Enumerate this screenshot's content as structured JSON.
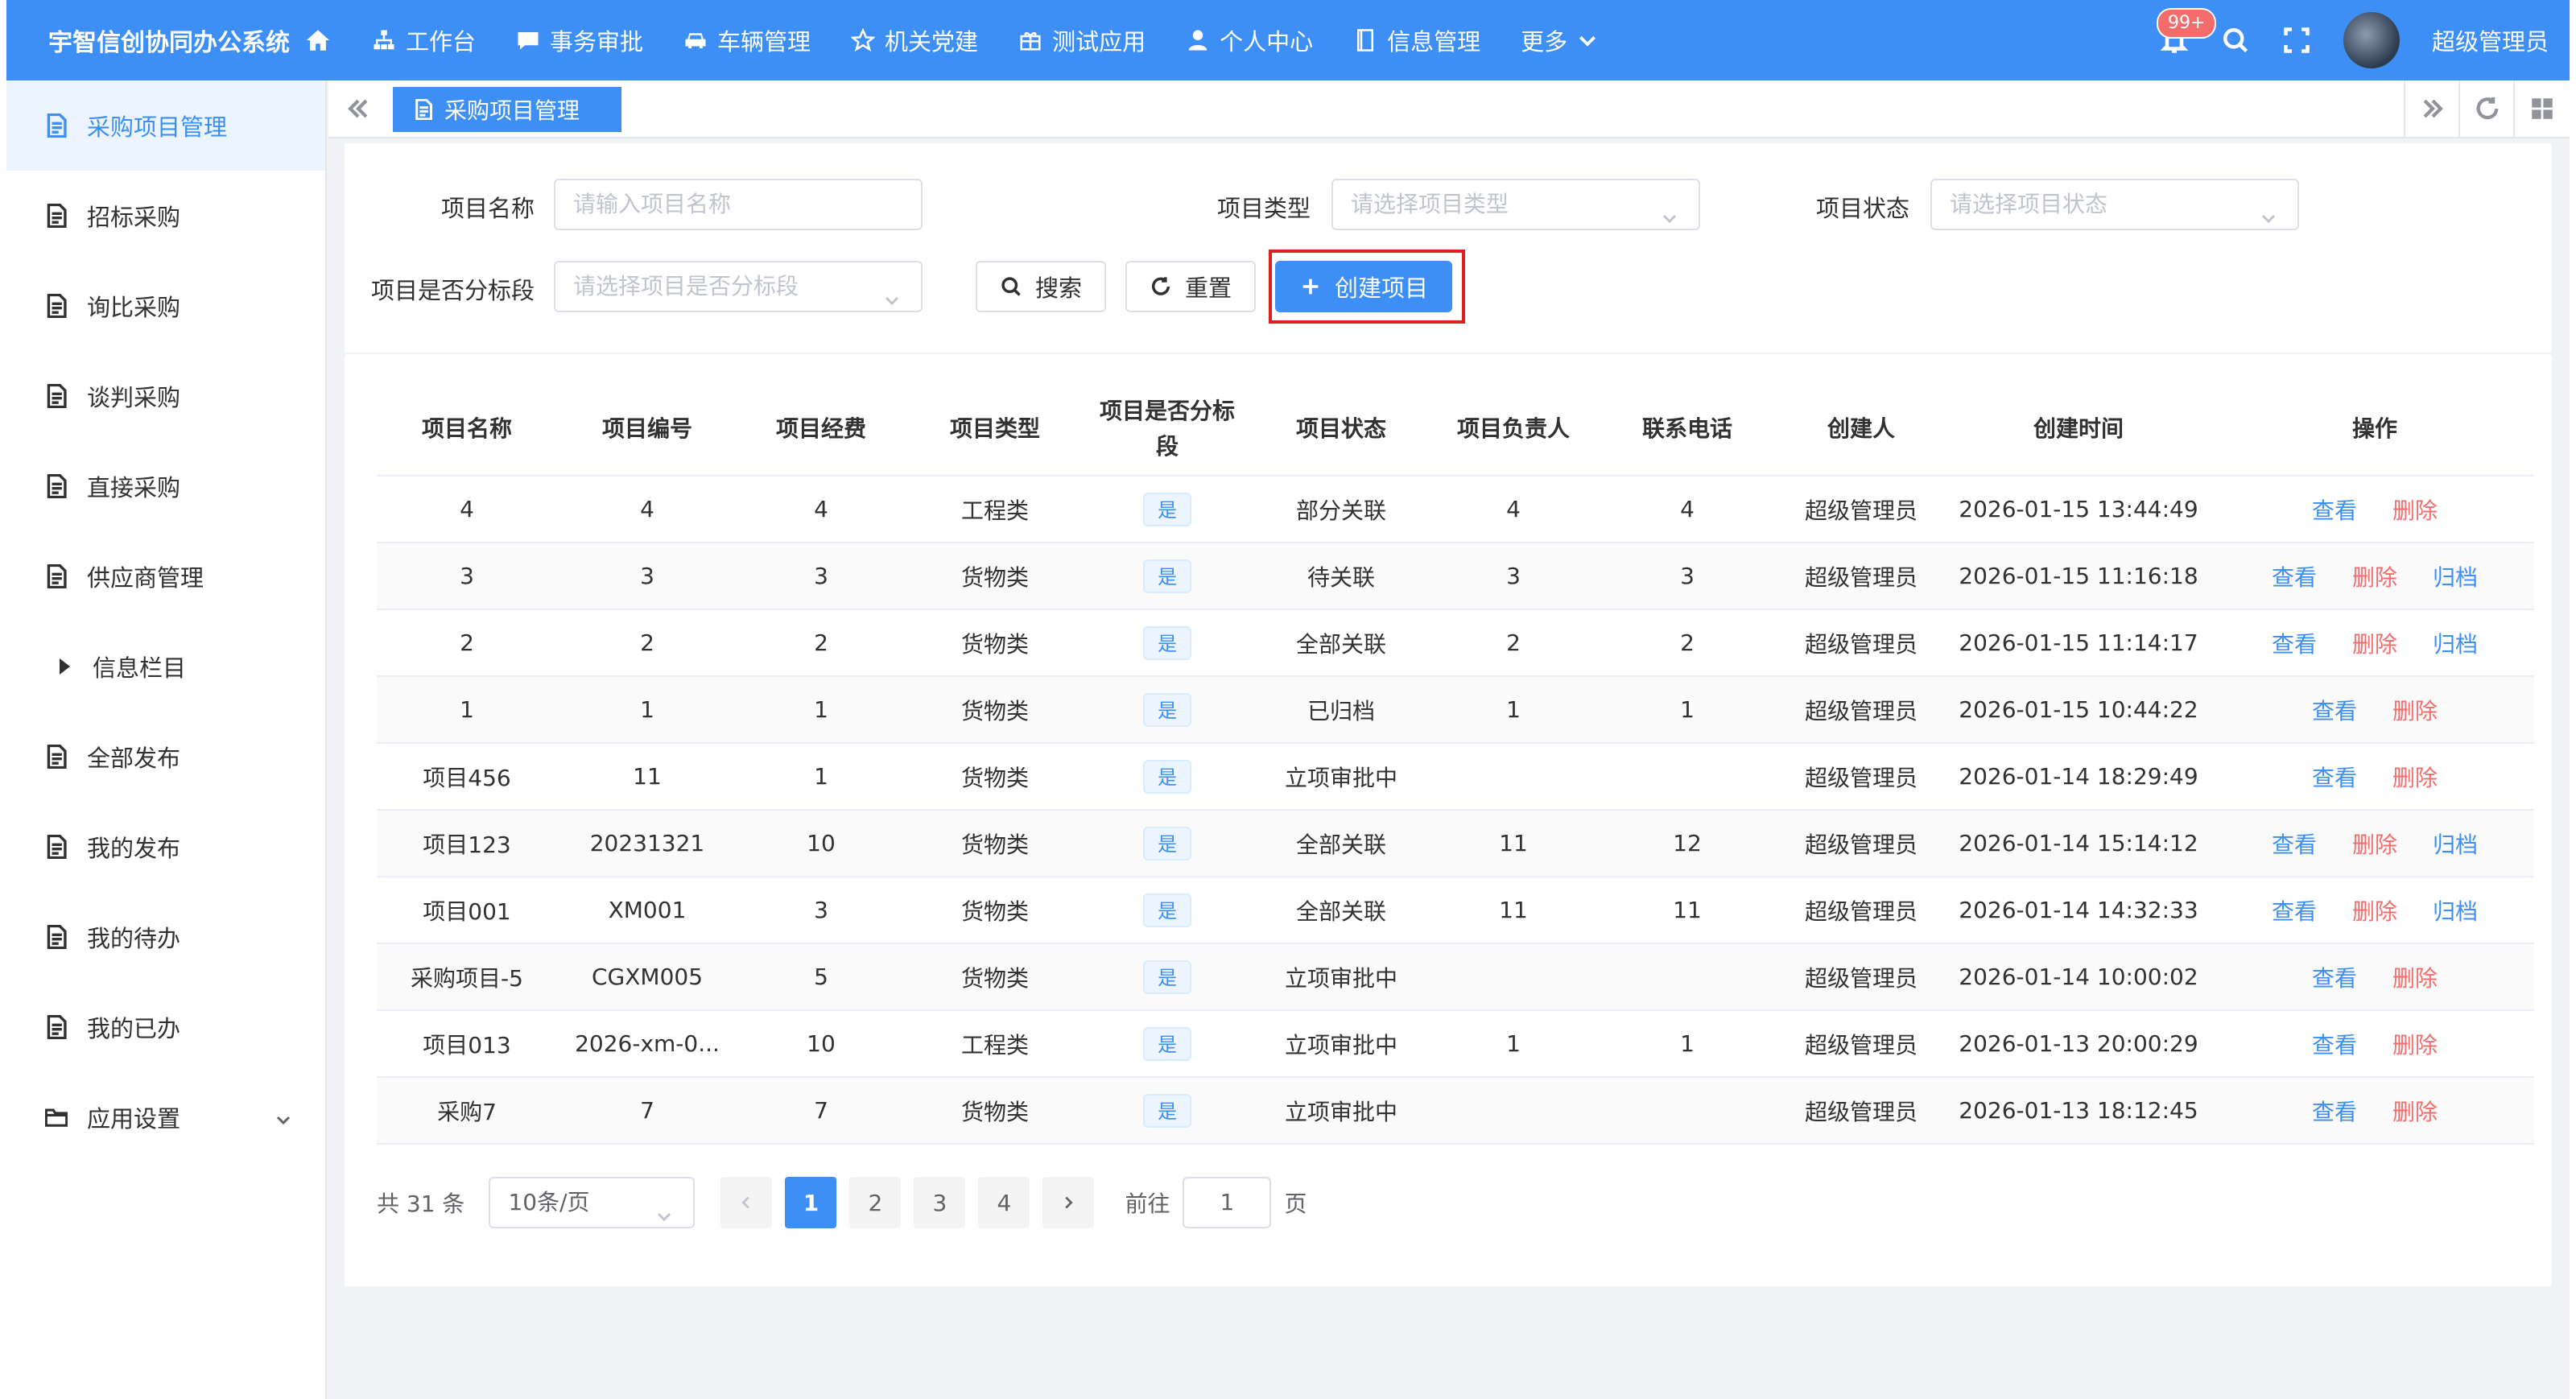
{
  "app": {
    "title": "宇智信创协同办公系统"
  },
  "nav": {
    "items": [
      {
        "label": "工作台"
      },
      {
        "label": "事务审批"
      },
      {
        "label": "车辆管理"
      },
      {
        "label": "机关党建"
      },
      {
        "label": "测试应用"
      },
      {
        "label": "个人中心"
      },
      {
        "label": "信息管理"
      },
      {
        "label": "更多"
      }
    ]
  },
  "header": {
    "notification_count": "99+",
    "user_name": "超级管理员"
  },
  "sidebar": {
    "items": [
      {
        "label": "采购项目管理",
        "icon": "document-icon",
        "active": true
      },
      {
        "label": "招标采购",
        "icon": "document-icon"
      },
      {
        "label": "询比采购",
        "icon": "document-icon"
      },
      {
        "label": "谈判采购",
        "icon": "document-icon"
      },
      {
        "label": "直接采购",
        "icon": "document-icon"
      },
      {
        "label": "供应商管理",
        "icon": "document-icon"
      },
      {
        "label": "信息栏目",
        "icon": "caret-right-icon"
      },
      {
        "label": "全部发布",
        "icon": "document-icon"
      },
      {
        "label": "我的发布",
        "icon": "document-icon"
      },
      {
        "label": "我的待办",
        "icon": "document-icon"
      },
      {
        "label": "我的已办",
        "icon": "document-icon"
      },
      {
        "label": "应用设置",
        "icon": "folder-icon"
      }
    ]
  },
  "tabs": {
    "active_label": "采购项目管理"
  },
  "search": {
    "name_label": "项目名称",
    "name_placeholder": "请输入项目名称",
    "type_label": "项目类型",
    "type_placeholder": "请选择项目类型",
    "status_label": "项目状态",
    "status_placeholder": "请选择项目状态",
    "segment_label": "项目是否分标段",
    "segment_placeholder": "请选择项目是否分标段",
    "search_button": "搜索",
    "reset_button": "重置",
    "create_button": "创建项目"
  },
  "table": {
    "columns": [
      "项目名称",
      "项目编号",
      "项目经费",
      "项目类型",
      "项目是否分标段",
      "项目状态",
      "项目负责人",
      "联系电话",
      "创建人",
      "创建时间",
      "操作"
    ],
    "rows": [
      {
        "name": "4",
        "code": "4",
        "budget": "4",
        "type": "工程类",
        "segmented": "是",
        "status": "部分关联",
        "manager": "4",
        "phone": "4",
        "creator": "超级管理员",
        "created": "2026-01-15 13:44:49",
        "ops": [
          "查看",
          "删除"
        ]
      },
      {
        "name": "3",
        "code": "3",
        "budget": "3",
        "type": "货物类",
        "segmented": "是",
        "status": "待关联",
        "manager": "3",
        "phone": "3",
        "creator": "超级管理员",
        "created": "2026-01-15 11:16:18",
        "ops": [
          "查看",
          "删除",
          "归档"
        ]
      },
      {
        "name": "2",
        "code": "2",
        "budget": "2",
        "type": "货物类",
        "segmented": "是",
        "status": "全部关联",
        "manager": "2",
        "phone": "2",
        "creator": "超级管理员",
        "created": "2026-01-15 11:14:17",
        "ops": [
          "查看",
          "删除",
          "归档"
        ]
      },
      {
        "name": "1",
        "code": "1",
        "budget": "1",
        "type": "货物类",
        "segmented": "是",
        "status": "已归档",
        "manager": "1",
        "phone": "1",
        "creator": "超级管理员",
        "created": "2026-01-15 10:44:22",
        "ops": [
          "查看",
          "删除"
        ]
      },
      {
        "name": "项目456",
        "code": "11",
        "budget": "1",
        "type": "货物类",
        "segmented": "是",
        "status": "立项审批中",
        "manager": "",
        "phone": "",
        "creator": "超级管理员",
        "created": "2026-01-14 18:29:49",
        "ops": [
          "查看",
          "删除"
        ]
      },
      {
        "name": "项目123",
        "code": "20231321",
        "budget": "10",
        "type": "货物类",
        "segmented": "是",
        "status": "全部关联",
        "manager": "11",
        "phone": "12",
        "creator": "超级管理员",
        "created": "2026-01-14 15:14:12",
        "ops": [
          "查看",
          "删除",
          "归档"
        ]
      },
      {
        "name": "项目001",
        "code": "XM001",
        "budget": "3",
        "type": "货物类",
        "segmented": "是",
        "status": "全部关联",
        "manager": "11",
        "phone": "11",
        "creator": "超级管理员",
        "created": "2026-01-14 14:32:33",
        "ops": [
          "查看",
          "删除",
          "归档"
        ]
      },
      {
        "name": "采购项目-5",
        "code": "CGXM005",
        "budget": "5",
        "type": "货物类",
        "segmented": "是",
        "status": "立项审批中",
        "manager": "",
        "phone": "",
        "creator": "超级管理员",
        "created": "2026-01-14 10:00:02",
        "ops": [
          "查看",
          "删除"
        ]
      },
      {
        "name": "项目013",
        "code": "2026-xm-0...",
        "budget": "10",
        "type": "工程类",
        "segmented": "是",
        "status": "立项审批中",
        "manager": "1",
        "phone": "1",
        "creator": "超级管理员",
        "created": "2026-01-13 20:00:29",
        "ops": [
          "查看",
          "删除"
        ]
      },
      {
        "name": "采购7",
        "code": "7",
        "budget": "7",
        "type": "货物类",
        "segmented": "是",
        "status": "立项审批中",
        "manager": "",
        "phone": "",
        "creator": "超级管理员",
        "created": "2026-01-13 18:12:45",
        "ops": [
          "查看",
          "删除"
        ]
      }
    ]
  },
  "pagination": {
    "total_text": "共 31 条",
    "page_size": "10条/页",
    "pages": [
      "1",
      "2",
      "3",
      "4"
    ],
    "current_page": "1",
    "goto_prefix": "前往",
    "goto_value": "1",
    "goto_suffix": "页"
  },
  "colors": {
    "primary": "#3d8ff5",
    "danger": "#f56c6c",
    "highlight_border": "#e02020"
  }
}
